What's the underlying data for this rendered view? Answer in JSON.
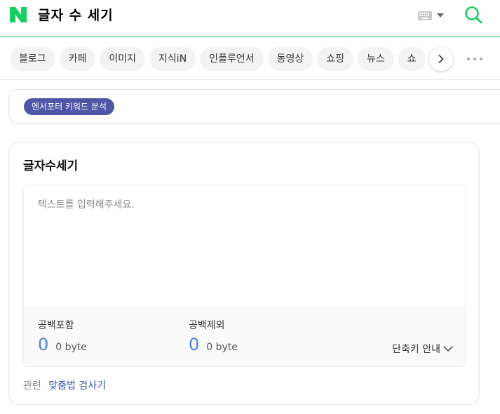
{
  "header": {
    "query": "글자 수 세기",
    "logo_letter": "N",
    "brand_color": "#19ce60",
    "keyboard_icon": "keyboard-icon",
    "search_icon": "search-icon"
  },
  "tabs": {
    "items": [
      "블로그",
      "카페",
      "이미지",
      "지식iN",
      "인플루언서",
      "동영상",
      "쇼핑",
      "뉴스",
      "쇼"
    ],
    "next_icon": "chevron-right-icon",
    "more_icon": "more-icon"
  },
  "keyword_bar": {
    "badge_label": "엔서포터 키워드 분석",
    "badge_color": "#4f56a6"
  },
  "counter": {
    "title": "글자수세기",
    "placeholder": "텍스트를 입력해주세요.",
    "with_spaces": {
      "label": "공백포함",
      "count": "0",
      "bytes": "0 byte"
    },
    "without_spaces": {
      "label": "공백제외",
      "count": "0",
      "bytes": "0 byte"
    },
    "shortcut_label": "단축키 안내",
    "count_color": "#4b82e6"
  },
  "related": {
    "label": "관련",
    "link": "맞춤법 검사기"
  }
}
